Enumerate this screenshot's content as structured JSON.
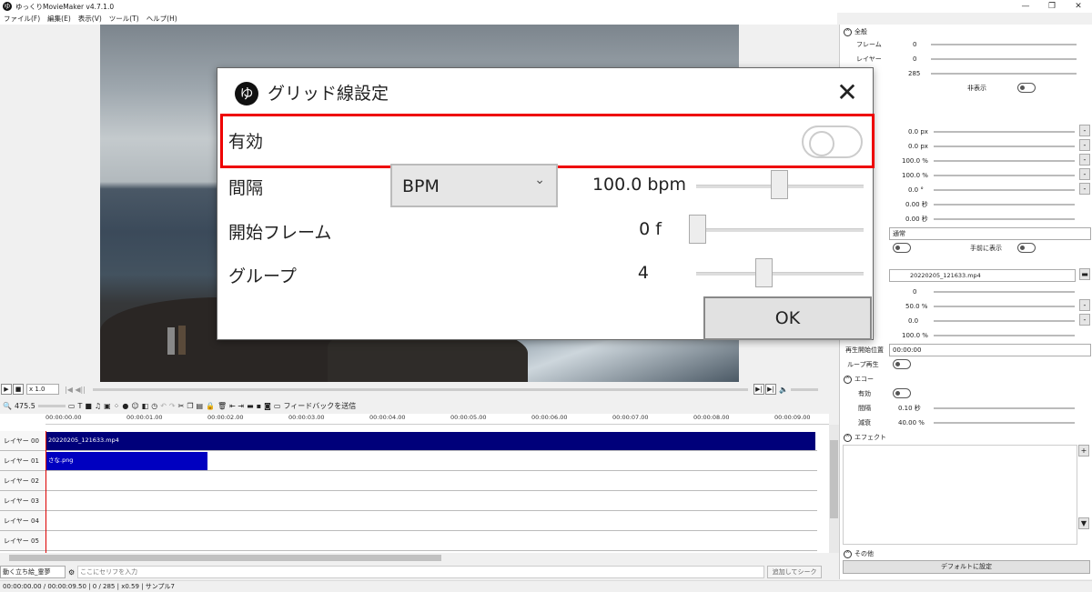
{
  "window": {
    "title": "ゆっくりMovieMaker v4.7.1.0",
    "icon_glyph": "ゆ",
    "minimize": "—",
    "maximize": "❐",
    "close": "✕"
  },
  "menu": [
    "ファイル(F)",
    "編集(E)",
    "表示(V)",
    "ツール(T)",
    "ヘルプ(H)"
  ],
  "playback": {
    "speed": "x 1.0",
    "volume_icon": "speaker-icon"
  },
  "toolbar": {
    "zoom": "475.5",
    "feedback": "フィードバックを送信"
  },
  "timeline": {
    "ticks": [
      "00:00:00.00",
      "00:00:01.00",
      "00:00:02.00",
      "00:00:03.00",
      "00:00:04.00",
      "00:00:05.00",
      "00:00:06.00",
      "00:00:07.00",
      "00:00:08.00",
      "00:00:09.00"
    ],
    "layers": [
      "レイヤー 00",
      "レイヤー 01",
      "レイヤー 02",
      "レイヤー 03",
      "レイヤー 04",
      "レイヤー 05"
    ],
    "clips": [
      {
        "name": "20220205_121633.mp4"
      },
      {
        "name": "さな.png"
      }
    ]
  },
  "inputbar": {
    "character": "動く立ち絵_霊夢",
    "placeholder": "ここにセリフを入力",
    "add_button": "追加してシーク"
  },
  "status": "00:00:00.00 / 00:00:09.50 | 0 / 285 | x0.59 | サンプル7",
  "right_panel": {
    "section_all": "全般",
    "frame_label": "フレーム",
    "frame_value": "0",
    "layer_label": "レイヤー",
    "layer_value": "0",
    "length_value": "285",
    "hidden_label": "非表示",
    "x": "0.0 px",
    "y": "0.0 px",
    "zoom": "100.0 %",
    "opacity": "100.0 %",
    "rotation": "0.0 °",
    "fadein": "0.00 秒",
    "fadeout": "0.00 秒",
    "blend": "通常",
    "front_label": "手前に表示",
    "file": "20220205_121633.mp4",
    "v1": "0",
    "v2": "50.0 %",
    "v3": "0.0",
    "v4": "100.0 %",
    "play_start_label": "再生開始位置",
    "play_start": "00:00:00",
    "loop_label": "ループ再生",
    "echo": "エコー",
    "echo_enabled": "有効",
    "interval_label": "間隔",
    "interval": "0.10 秒",
    "decay_label": "減衰",
    "decay": "40.00 %",
    "effect": "エフェクト",
    "other": "その他",
    "default_button": "デフォルトに設定"
  },
  "dialog": {
    "title": "グリッド線設定",
    "enabled_label": "有効",
    "interval_label": "間隔",
    "interval_mode": "BPM",
    "interval_value": "100.0 bpm",
    "start_label": "開始フレーム",
    "start_value": "0 f",
    "group_label": "グループ",
    "group_value": "4",
    "ok": "OK",
    "close": "✕"
  }
}
